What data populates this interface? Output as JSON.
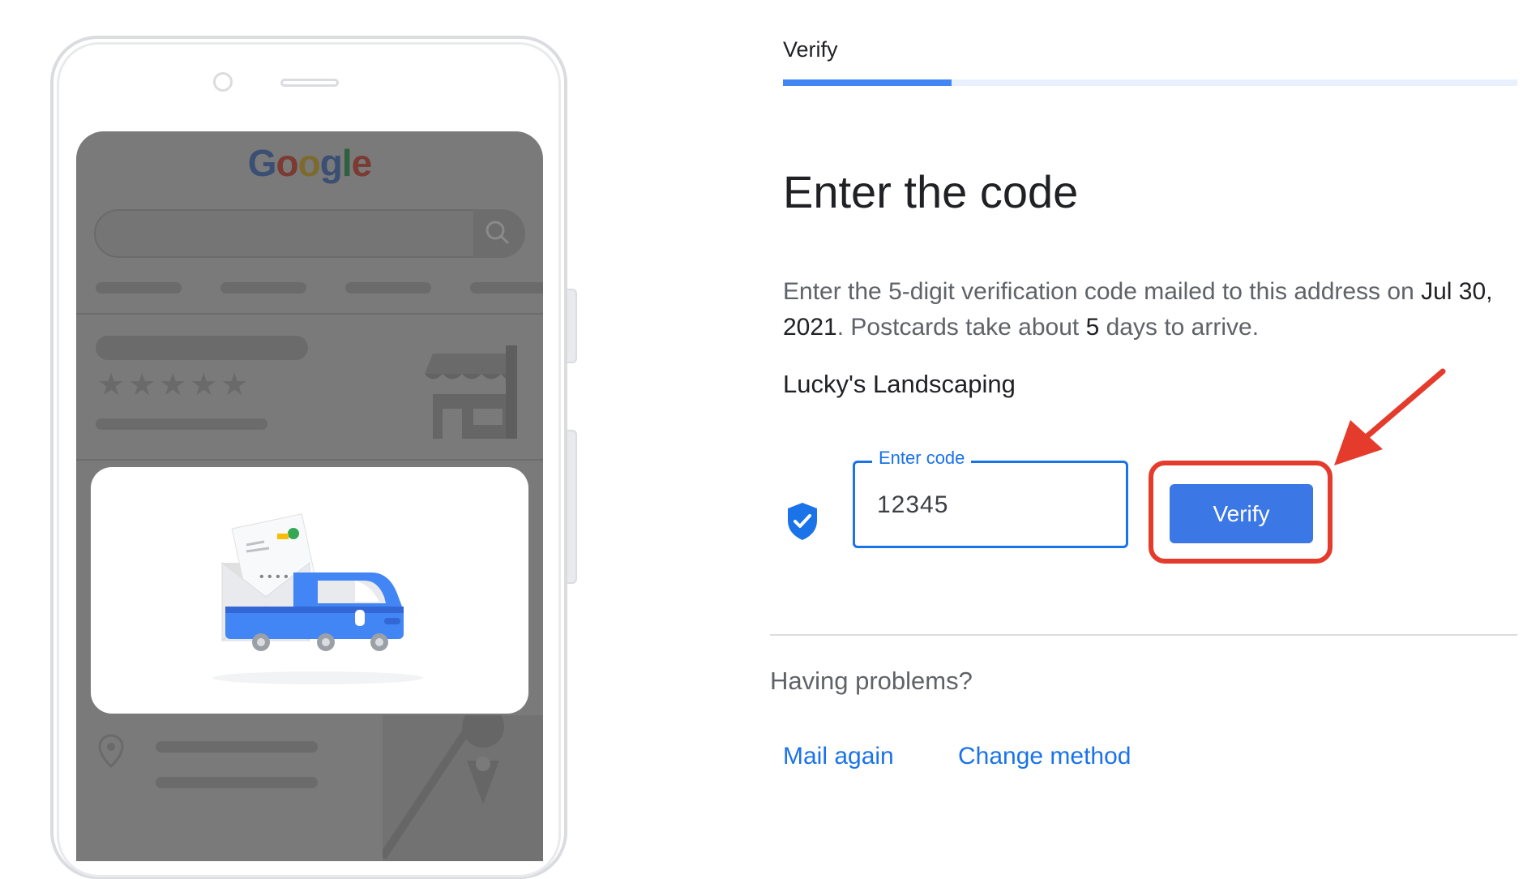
{
  "phone": {
    "logo_text": "Google",
    "logo_colors": [
      "#3a4f73",
      "#7b3a32",
      "#7d6a2e",
      "#3a4f73",
      "#2f6040",
      "#7b3a32"
    ],
    "rating_stars": "★★★★★",
    "illustration": "postcard-delivery-truck"
  },
  "progress": {
    "step_label": "Verify",
    "fraction_complete": 0.23,
    "track_color": "#e8f0fe",
    "fill_color": "#4285f4"
  },
  "main": {
    "title": "Enter the code",
    "description_prefix": "Enter the 5-digit verification code mailed to this address on ",
    "mail_date": "Jul 30, 2021",
    "description_middle": ". Postcards take about ",
    "days": "5",
    "description_suffix": " days to arrive.",
    "business_name": "Lucky's Landscaping"
  },
  "code_form": {
    "field_label": "Enter code",
    "field_value": "12345",
    "verify_label": "Verify",
    "accent_color": "#1a73e8",
    "highlight_color": "#e53b2c"
  },
  "help": {
    "heading": "Having problems?",
    "mail_again_label": "Mail again",
    "change_method_label": "Change method"
  }
}
